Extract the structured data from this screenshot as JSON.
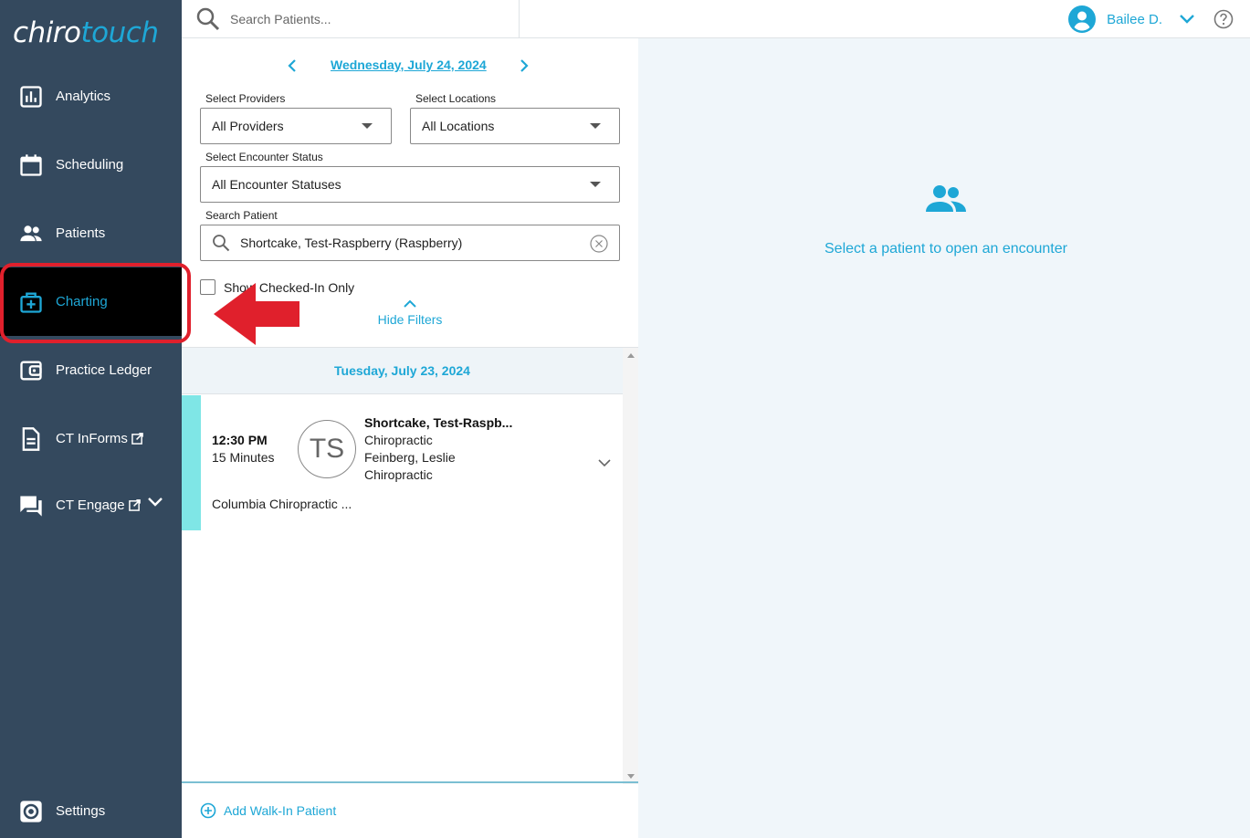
{
  "app": {
    "logo_part1": "chiro",
    "logo_part2": "touch"
  },
  "sidebar": {
    "items": [
      {
        "label": "Analytics",
        "icon": "analytics-icon"
      },
      {
        "label": "Scheduling",
        "icon": "calendar-icon"
      },
      {
        "label": "Patients",
        "icon": "people-icon"
      },
      {
        "label": "Charting",
        "icon": "medical-bag-icon",
        "active": true
      },
      {
        "label": "Practice Ledger",
        "icon": "wallet-icon"
      },
      {
        "label": "CT InForms",
        "icon": "document-icon",
        "external": true
      },
      {
        "label": "CT Engage",
        "icon": "chat-icon",
        "external": true,
        "expandable": true
      }
    ],
    "settings_label": "Settings"
  },
  "topbar": {
    "search_placeholder": "Search Patients...",
    "user_name": "Bailee D."
  },
  "filters": {
    "date_label": "Wednesday, July 24, 2024",
    "providers_label": "Select Providers",
    "providers_value": "All Providers",
    "locations_label": "Select Locations",
    "locations_value": "All Locations",
    "status_label": "Select Encounter Status",
    "status_value": "All Encounter Statuses",
    "search_label": "Search Patient",
    "search_value": "Shortcake, Test-Raspberry (Raspberry)",
    "checked_in_label": "Show Checked-In Only",
    "hide_filters_label": "Hide Filters"
  },
  "appointments": {
    "day_header": "Tuesday, July 23, 2024",
    "items": [
      {
        "time": "12:30 PM",
        "duration": "15 Minutes",
        "initials": "TS",
        "patient_name": "Shortcake, Test-Raspb...",
        "visit_type": "Chiropractic",
        "provider": "Feinberg, Leslie",
        "provider_type": "Chiropractic",
        "location": "Columbia Chiropractic ...",
        "status_color": "#7fe6e6"
      }
    ],
    "walkin_label": "Add Walk-In Patient"
  },
  "right_panel": {
    "message": "Select a patient to open an encounter"
  },
  "colors": {
    "sidebar_bg": "#34495e",
    "accent": "#1ea7d6",
    "annotation_red": "#e0202c"
  }
}
